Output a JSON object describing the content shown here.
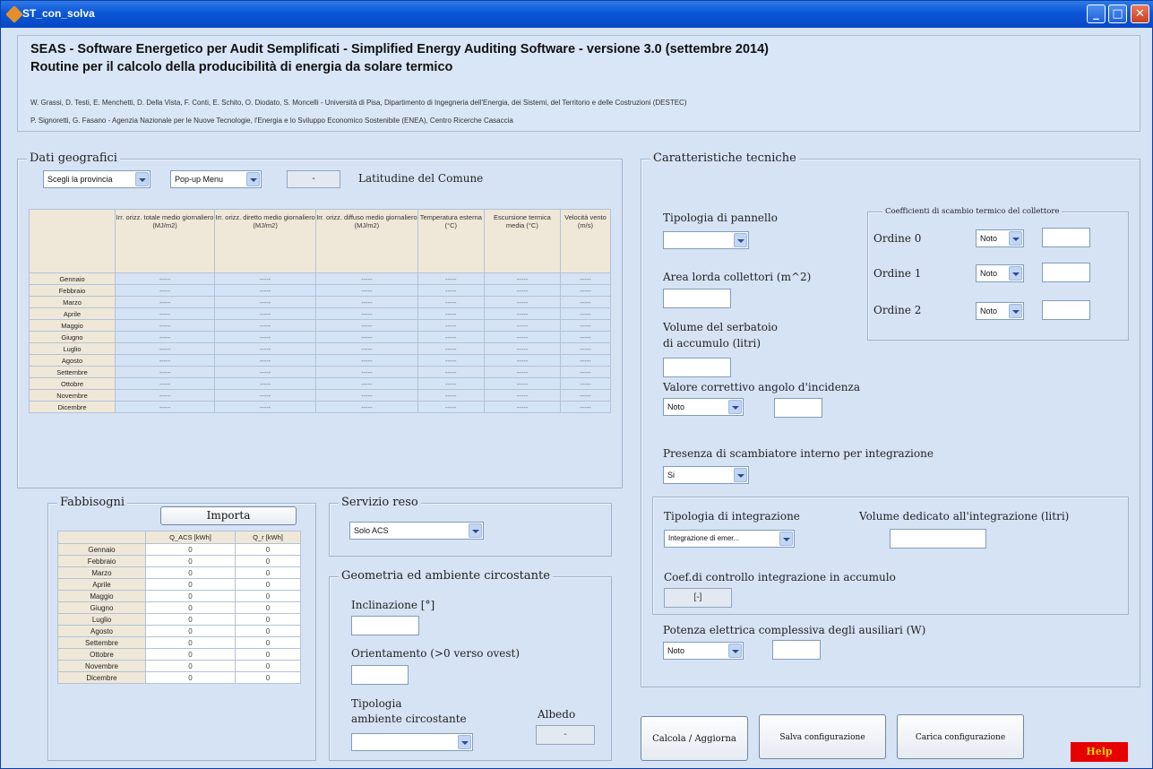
{
  "window": {
    "title": "ST_con_solva"
  },
  "header": {
    "line1": "SEAS - Software Energetico per Audit Semplificati - Simplified Energy Auditing Software - versione 3.0 (settembre 2014)",
    "line2": "Routine per il calcolo della producibilità di energia da solare termico",
    "authors1": "W. Grassi, D. Testi, E. Menchetti, D. Della Vista, F. Conti, E. Schito, O. Diodato, S. Moncelli - Università di Pisa, Dipartimento di Ingegneria dell'Energia, dei Sistemi, del Territorio e delle Costruzioni (DESTEC)",
    "authors2": "P. Signoretti, G. Fasano - Agenzia Nazionale per le Nuove Tecnologie, l'Energia e lo Sviluppo Economico Sostenibile (ENEA), Centro Ricerche Casaccia"
  },
  "geo": {
    "legend": "Dati geografici",
    "province": "Scegli la provincia",
    "comune": "Pop-up Menu",
    "lat_value": "-",
    "lat_label": "Latitudine del Comune",
    "columns": [
      "Irr. orizz. totale medio giornaliero (MJ/m2)",
      "Irr. orizz. diretto medio giornaliero (MJ/m2)",
      "Irr. orizz. diffuso medio giornaliero (MJ/m2)",
      "Temperatura esterna (°C)",
      "Escursione termica media (°C)",
      "Velocità vento (m/s)"
    ],
    "placeholder": "-----"
  },
  "months": [
    "Gennaio",
    "Febbraio",
    "Marzo",
    "Aprile",
    "Maggio",
    "Giugno",
    "Luglio",
    "Agosto",
    "Settembre",
    "Ottobre",
    "Novembre",
    "Dicembre"
  ],
  "needs": {
    "legend": "Fabbisogni",
    "import_label": "Importa",
    "columns": [
      "Q_ACS [kWh]",
      "Q_r [kWh]"
    ],
    "value": "0"
  },
  "service": {
    "legend": "Servizio reso",
    "value": "Solo ACS"
  },
  "geometry": {
    "legend": "Geometria ed ambiente circostante",
    "tilt_label": "Inclinazione [°]",
    "orient_label": "Orientamento (>0 verso ovest)",
    "env_label_1": "Tipologia",
    "env_label_2": "ambiente circostante",
    "albedo_label": "Albedo",
    "albedo_value": "-"
  },
  "tech": {
    "legend": "Caratteristiche tecniche",
    "panel_type": "Tipologia di pannello",
    "area": "Area lorda collettori (m^2)",
    "volume_1": "Volume del serbatoio",
    "volume_2": "di accumulo (litri)",
    "iam": "Valore correttivo angolo d'incidenza",
    "iam_value": "Noto",
    "exchanger": "Presenza di scambiatore interno per integrazione",
    "exchanger_value": "Si",
    "coef_legend": "Coefficienti di scambio termico del collettore",
    "order0": "Ordine 0",
    "order1": "Ordine 1",
    "order2": "Ordine 2",
    "noto": "Noto",
    "integ_type": "Tipologia di integrazione",
    "integ_value": "Integrazione di emer...",
    "integ_volume": "Volume dedicato all'integrazione (litri)",
    "coef_ctrl": "Coef.di controllo integrazione in accumulo",
    "coef_ctrl_value": "[-]",
    "aux_power": "Potenza elettrica complessiva degli ausiliari (W)",
    "aux_value": "Noto"
  },
  "actions": {
    "calc": "Calcola / Aggiorna",
    "save": "Salva configurazione",
    "load": "Carica configurazione",
    "help": "Help"
  }
}
